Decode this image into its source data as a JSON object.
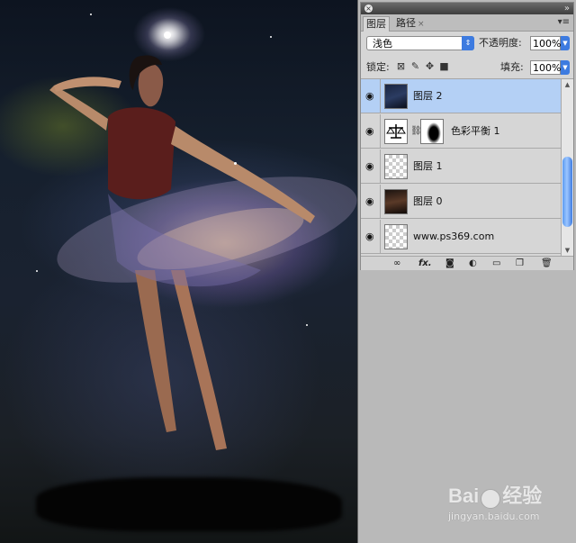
{
  "panel": {
    "tabs": [
      {
        "label": "图层",
        "active": true
      },
      {
        "label": "路径",
        "active": false
      }
    ],
    "blend_mode": "浅色",
    "opacity_label": "不透明度:",
    "opacity_value": "100%",
    "lock_label": "锁定:",
    "fill_label": "填充:",
    "fill_value": "100%",
    "layers": [
      {
        "name": "图层 2",
        "selected": true
      },
      {
        "name": "色彩平衡 1",
        "selected": false
      },
      {
        "name": "图层 1",
        "selected": false
      },
      {
        "name": "图层 0",
        "selected": false
      },
      {
        "name": "www.ps369.com",
        "selected": false
      }
    ],
    "bottom_icons": [
      "link-icon",
      "fx-icon",
      "mask-icon",
      "adjustment-icon",
      "folder-icon",
      "new-layer-icon",
      "trash-icon"
    ],
    "fx_label": "fx."
  },
  "watermark": {
    "logo_left": "Bai",
    "logo_right": "经验",
    "url": "jingyan.baidu.com"
  },
  "colors": {
    "selection": "#b4d0f5",
    "accent": "#3d7be0"
  }
}
